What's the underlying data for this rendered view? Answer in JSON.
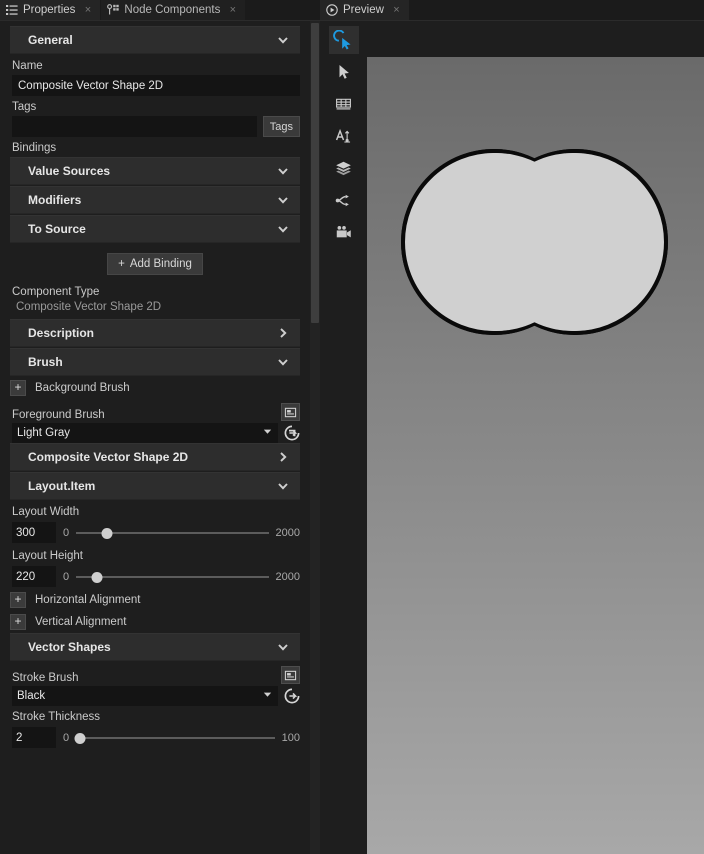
{
  "left_panel": {
    "tabs": [
      {
        "label": "Properties",
        "icon": "list-icon",
        "active": true,
        "close": "×"
      },
      {
        "label": "Node Components",
        "icon": "node-components-icon",
        "active": false,
        "close": "×"
      }
    ],
    "sections": {
      "general": "General",
      "description": "Description",
      "brush": "Brush",
      "composite_vector_shape": "Composite Vector Shape 2D",
      "layout_item": "Layout.Item",
      "vector_shapes": "Vector Shapes"
    },
    "general": {
      "name_label": "Name",
      "name_value": "Composite Vector Shape 2D",
      "tags_label": "Tags",
      "tags_value": "",
      "tags_button": "Tags",
      "bindings_label": "Bindings",
      "value_sources": "Value Sources",
      "modifiers": "Modifiers",
      "to_source": "To Source",
      "add_binding": "Add Binding",
      "add_binding_plus": "+",
      "component_type_label": "Component Type",
      "component_type_value": "Composite Vector Shape 2D"
    },
    "brush": {
      "background_brush_label": "Background Brush",
      "background_brush_plus": "+",
      "foreground_brush_label": "Foreground Brush",
      "foreground_brush_value": "Light Gray"
    },
    "layout": {
      "width_label": "Layout Width",
      "width_value": "300",
      "width_min": "0",
      "width_max": "2000",
      "width_knob_pct": 16,
      "height_label": "Layout Height",
      "height_value": "220",
      "height_min": "0",
      "height_max": "2000",
      "height_knob_pct": 11,
      "horizontal_alignment_label": "Horizontal Alignment",
      "horizontal_alignment_plus": "+",
      "vertical_alignment_label": "Vertical Alignment",
      "vertical_alignment_plus": "+"
    },
    "vector_shapes": {
      "stroke_brush_label": "Stroke Brush",
      "stroke_brush_value": "Black",
      "stroke_thickness_label": "Stroke Thickness",
      "stroke_thickness_value": "2",
      "stroke_thickness_min": "0",
      "stroke_thickness_max": "100",
      "stroke_thickness_knob_pct": 2
    }
  },
  "right_panel": {
    "tabs": [
      {
        "label": "Preview",
        "icon": "play-circle-icon",
        "active": true,
        "close": "×"
      }
    ],
    "toolbar": [
      {
        "name": "interact-tool",
        "active": true
      },
      {
        "name": "select-tool",
        "active": false
      },
      {
        "name": "grid-tool",
        "active": false
      },
      {
        "name": "text-tool",
        "active": false
      },
      {
        "name": "layers-tool",
        "active": false
      },
      {
        "name": "nodes-tool",
        "active": false
      },
      {
        "name": "camera-tool",
        "active": false
      }
    ],
    "canvas": {
      "shape_fill": "#d0d0d0",
      "shape_stroke": "#0a0a0a",
      "background_top": "#6a6a6a",
      "background_bottom": "#a8a8a8"
    }
  }
}
